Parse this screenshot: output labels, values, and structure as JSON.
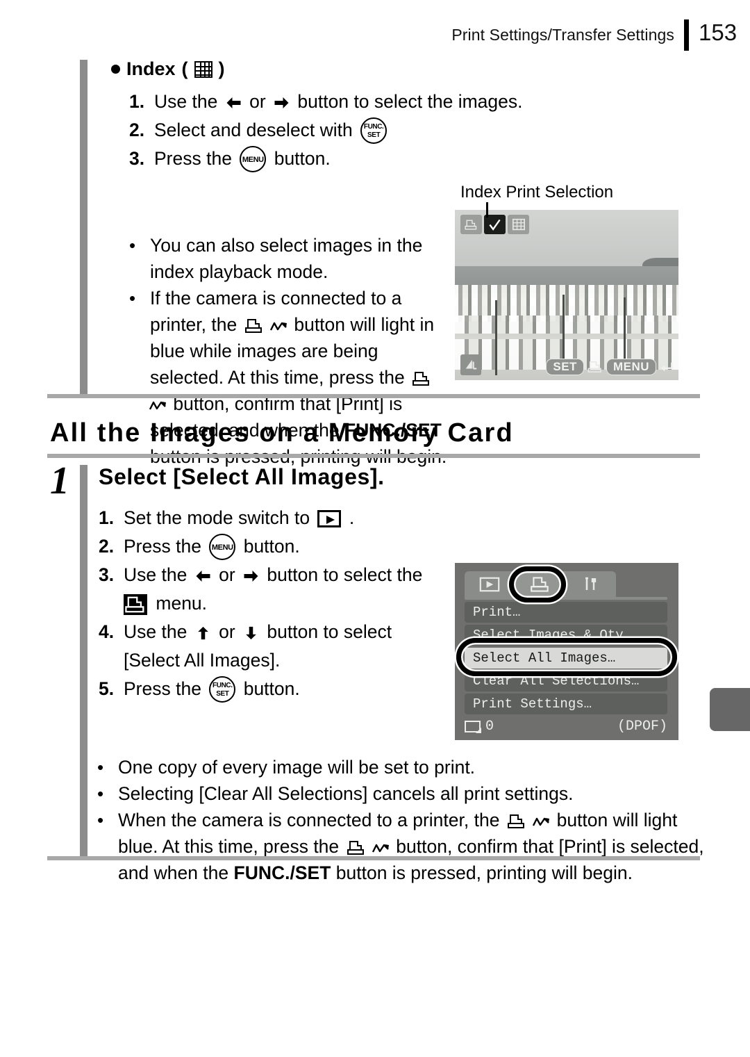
{
  "header": {
    "title": "Print Settings/Transfer Settings",
    "page_number": "153"
  },
  "index_section": {
    "heading": "Index",
    "heading_icon": "index-grid-icon",
    "paren_open": "(",
    "paren_close": ")",
    "steps": [
      {
        "num": "1.",
        "pre": "Use the",
        "mid": "or",
        "post": "button to select the images."
      },
      {
        "num": "2.",
        "pre": "Select and deselect with",
        "post": ""
      },
      {
        "num": "3.",
        "pre": "Press the",
        "post": "button."
      }
    ],
    "bullets": [
      {
        "text": "You can also select images in the index playback mode."
      },
      {
        "seg1": "If the camera is connected to a",
        "seg2": "printer, the",
        "seg3": "button will light in blue while images are being selected. At this time, press the",
        "seg4": "button, confirm that [Print] is selected, and when the",
        "bold": "FUNC./SET",
        "seg5": "button is pressed, printing will begin."
      }
    ]
  },
  "lcd_screen": {
    "caption": "Index Print Selection",
    "top_icons": [
      "print-icon",
      "checkmark-icon",
      "index-grid-icon"
    ],
    "bottom_keys": [
      "SET",
      "print-icon",
      "MENU",
      "return-arrow-icon"
    ],
    "quality_icon": "image-quality-icon",
    "photo_description": "beach-with-umbrellas-and-loungers"
  },
  "memory_card_section": {
    "title": "All the Images on a Memory Card",
    "step_number": "1",
    "step_title": "Select [Select All Images].",
    "steps": [
      {
        "num": "1.",
        "pre": "Set the mode switch to",
        "post": "."
      },
      {
        "num": "2.",
        "pre": "Press the",
        "post": "button."
      },
      {
        "num": "3.",
        "pre": "Use the",
        "mid": "or",
        "post": "button to select the",
        "post2": "menu."
      },
      {
        "num": "4.",
        "pre": "Use the",
        "mid": "or",
        "post": "button to select",
        "post2": "[Select All Images]."
      },
      {
        "num": "5.",
        "pre": "Press the",
        "post": "button."
      }
    ],
    "bullets": [
      {
        "text": "One copy of every image will be set to print."
      },
      {
        "text": "Selecting [Clear All Selections] cancels all print settings."
      },
      {
        "seg1": "When the camera is connected to a printer, the",
        "seg2": "button will light blue. At this time, press the",
        "seg3": "button, confirm that [Print] is selected, and when the",
        "bold": "FUNC./SET",
        "seg4": "button is pressed, printing will begin."
      }
    ]
  },
  "menu_screen": {
    "tabs": [
      "playback-icon",
      "print-icon",
      "settings-tools-icon"
    ],
    "items": [
      {
        "label": "Print…",
        "selected": false
      },
      {
        "label": "Select Images & Qty…",
        "selected": false
      },
      {
        "label": "Select All Images…",
        "selected": true
      },
      {
        "label": "Clear All Selections…",
        "selected": false
      },
      {
        "label": "Print Settings…",
        "selected": false
      }
    ],
    "footer_count": "0",
    "footer_right": "(DPOF)"
  },
  "buttons": {
    "func_line1": "FUNC.",
    "func_line2": "SET",
    "menu_label": "MENU"
  },
  "colors": {
    "rail_gray": "#8c8c8c",
    "rule_gray": "#a8a8a8",
    "tab_gray": "#666766",
    "menu_bg": "#6f706e",
    "menu_item_bg": "#5e605e",
    "menu_item_sel_bg": "#d9dad7"
  }
}
